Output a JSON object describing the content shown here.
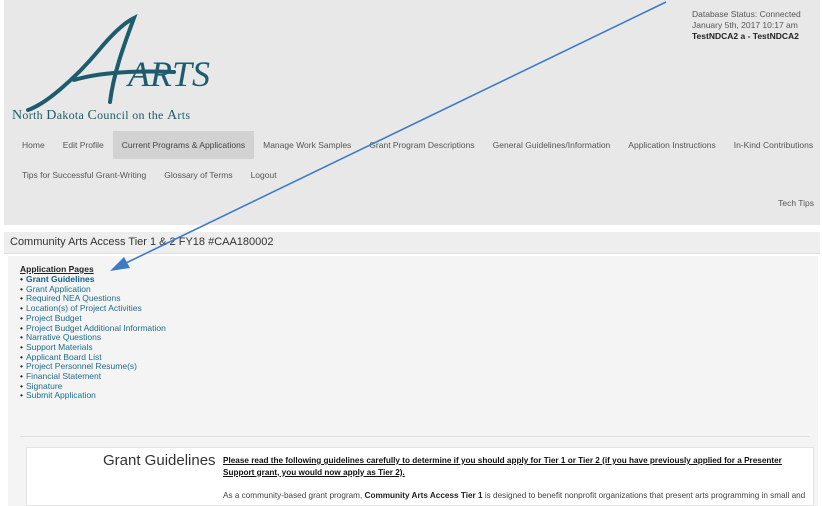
{
  "header": {
    "logo_letters": "ARTS",
    "org_name": {
      "n": "N",
      "orth": "orth ",
      "d": "D",
      "akota": "akota ",
      "c": "C",
      "ouncil": "ouncil on the ",
      "a": "A",
      "rts": "rts"
    },
    "status": {
      "line1": "Database Status: Connected",
      "line2": "January 5th, 2017 10:17 am",
      "line3": "TestNDCA2 a - TestNDCA2"
    }
  },
  "nav": {
    "row1": [
      "Home",
      "Edit Profile",
      "Current Programs & Applications",
      "Manage Work Samples",
      "Grant Program Descriptions",
      "General Guidelines/Information",
      "Application Instructions",
      "In-Kind Contributions"
    ],
    "row2": [
      "Tips for Successful Grant-Writing",
      "Glossary of Terms",
      "Logout"
    ],
    "tech_tips": "Tech Tips",
    "active_index": 2
  },
  "page_title": "Community Arts Access Tier 1 & 2 FY18 #CAA180002",
  "application_pages": {
    "title": "Application Pages",
    "items": [
      "Grant Guidelines",
      "Grant Application",
      "Required NEA Questions",
      "Location(s) of Project Activities",
      "Project Budget",
      "Project Budget Additional Information",
      "Narrative Questions",
      "Support Materials",
      "Applicant Board List",
      "Project Personnel Resume(s)",
      "Financial Statement",
      "Signature",
      "Submit Application"
    ],
    "active_index": 0
  },
  "guidelines": {
    "heading": "Grant Guidelines",
    "note": "Please read the following guidelines carefully to determine if you should apply for Tier 1 or Tier 2 (if you have previously applied for a Presenter Support grant, you would now apply as Tier 2).",
    "body_pre": "As a community-based grant program, ",
    "body_bold": "Community Arts Access Tier 1",
    "body_post": " is designed to benefit nonprofit organizations that present arts programming in small and"
  },
  "colors": {
    "header_bg": "#e8e8e8",
    "logo_teal": "#1d5c6d",
    "link_blue": "#1d6e8b",
    "arrow_blue": "#3b7cc4"
  }
}
